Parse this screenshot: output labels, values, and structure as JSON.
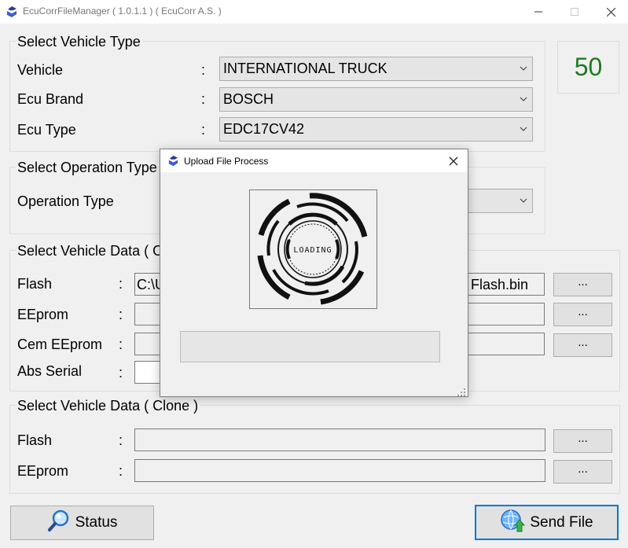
{
  "window": {
    "title": "EcuCorrFileManager ( 1.0.1.1 ) ( EcuCorr A.S. )",
    "counter": "50"
  },
  "vehicle_type": {
    "title": "Select Vehicle Type",
    "rows": [
      {
        "label": "Vehicle",
        "colon": ":",
        "value": "INTERNATIONAL TRUCK"
      },
      {
        "label": "Ecu Brand",
        "colon": ":",
        "value": "BOSCH"
      },
      {
        "label": "Ecu Type",
        "colon": ":",
        "value": "EDC17CV42"
      }
    ]
  },
  "operation": {
    "title": "Select Operation Type",
    "label": "Operation Type",
    "value": ""
  },
  "vehicle_data_original": {
    "title": "Select Vehicle Data ( Original )",
    "rows": [
      {
        "label": "Flash",
        "colon": ":",
        "value": "C:\\Users\\...\\Flash.bin",
        "value_start": "C:\\U",
        "value_end": "Flash.bin",
        "button": "..."
      },
      {
        "label": "EEprom",
        "colon": ":",
        "value": "",
        "button": "..."
      },
      {
        "label": "Cem EEprom",
        "colon": ":",
        "value": "",
        "button": "..."
      },
      {
        "label": "Abs Serial",
        "colon": ":",
        "value": ""
      }
    ]
  },
  "vehicle_data_clone": {
    "title": "Select Vehicle Data ( Clone )",
    "rows": [
      {
        "label": "Flash",
        "colon": ":",
        "value": "",
        "button": "..."
      },
      {
        "label": "EEprom",
        "colon": ":",
        "value": "",
        "button": "..."
      }
    ]
  },
  "buttons": {
    "status": "Status",
    "send": "Send File"
  },
  "dialog": {
    "title": "Upload File Process",
    "loading_text": "LOADING",
    "progress": 0
  },
  "colors": {
    "counter": "#1e7b1e",
    "accent": "#0078d7"
  }
}
